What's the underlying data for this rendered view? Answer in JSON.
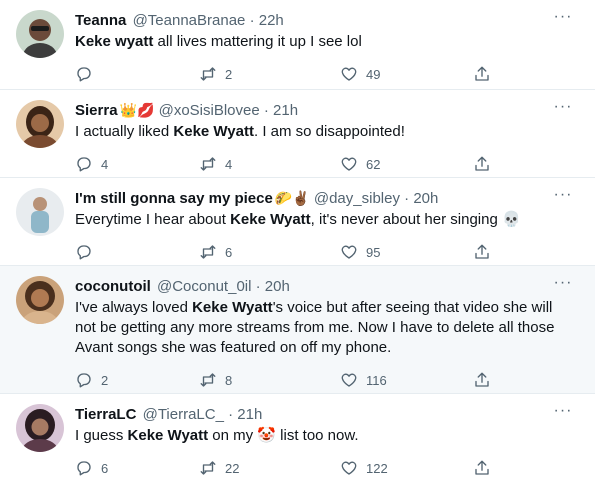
{
  "tweets": [
    {
      "name": "Teanna",
      "name_emoji": "",
      "handle": "@TeannaBranae",
      "dot": "·",
      "time": "22h",
      "text_segments": [
        {
          "t": "Keke wyatt",
          "bold": true
        },
        {
          "t": " all lives mattering it up I see lol",
          "bold": false
        }
      ],
      "replies": "",
      "retweets": "2",
      "likes": "49",
      "highlighted": false
    },
    {
      "name": "Sierra",
      "name_emoji": "👑💋",
      "handle": "@xoSisiBlovee",
      "dot": "·",
      "time": "21h",
      "text_segments": [
        {
          "t": "I actually liked ",
          "bold": false
        },
        {
          "t": "Keke Wyatt",
          "bold": true
        },
        {
          "t": ". I am so disappointed!",
          "bold": false
        }
      ],
      "replies": "4",
      "retweets": "4",
      "likes": "62",
      "highlighted": false
    },
    {
      "name": "I'm still gonna say my piece",
      "name_emoji": "🌮✌🏾",
      "handle": "@day_sibley",
      "dot": "·",
      "time": "20h",
      "text_segments": [
        {
          "t": "Everytime I hear about ",
          "bold": false
        },
        {
          "t": "Keke Wyatt",
          "bold": true
        },
        {
          "t": ", it's never about her singing 💀",
          "bold": false
        }
      ],
      "replies": "",
      "retweets": "6",
      "likes": "95",
      "highlighted": false
    },
    {
      "name": "coconutoil",
      "name_emoji": "",
      "handle": "@Coconut_0il",
      "dot": "·",
      "time": "20h",
      "text_segments": [
        {
          "t": "I've always loved ",
          "bold": false
        },
        {
          "t": "Keke Wyatt",
          "bold": true
        },
        {
          "t": "'s voice but after seeing that video she will not be getting any more streams from me. Now I have to delete all those Avant songs she was featured on off my phone.",
          "bold": false
        }
      ],
      "replies": "2",
      "retweets": "8",
      "likes": "116",
      "highlighted": true
    },
    {
      "name": "TierraLC",
      "name_emoji": "",
      "handle": "@TierraLC_",
      "dot": "·",
      "time": "21h",
      "text_segments": [
        {
          "t": "I guess ",
          "bold": false
        },
        {
          "t": "Keke Wyatt",
          "bold": true
        },
        {
          "t": " on my 🤡 list too now.",
          "bold": false
        }
      ],
      "replies": "6",
      "retweets": "22",
      "likes": "122",
      "highlighted": false
    }
  ],
  "more_label": "···",
  "colors": {
    "text": "#0f1419",
    "muted": "#536471",
    "border": "#e6ecf0",
    "highlight_bg": "#f5f8fa"
  },
  "icons": [
    "reply-icon",
    "retweet-icon",
    "like-icon",
    "share-icon",
    "more-icon"
  ]
}
